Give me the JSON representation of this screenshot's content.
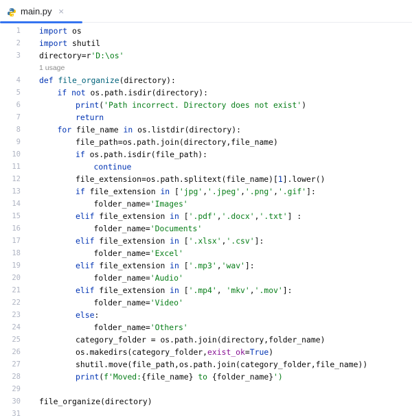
{
  "tab": {
    "filename": "main.py",
    "close": "×"
  },
  "usage_hint": "1 usage",
  "lines": [
    {
      "n": "1",
      "indent": 0,
      "tokens": [
        {
          "t": "import",
          "c": "kw"
        },
        {
          "t": " os"
        }
      ]
    },
    {
      "n": "2",
      "indent": 0,
      "tokens": [
        {
          "t": "import",
          "c": "kw"
        },
        {
          "t": " shutil"
        }
      ]
    },
    {
      "n": "3",
      "indent": 0,
      "tokens": [
        {
          "t": "directory=r"
        },
        {
          "t": "'D:\\os'",
          "c": "str"
        }
      ]
    },
    {
      "n": "4",
      "indent": 0,
      "usage": true,
      "tokens": [
        {
          "t": "def",
          "c": "kw"
        },
        {
          "t": " "
        },
        {
          "t": "file_organize",
          "c": "fn"
        },
        {
          "t": "(directory):"
        }
      ]
    },
    {
      "n": "5",
      "indent": 1,
      "tokens": [
        {
          "t": "if not",
          "c": "kw"
        },
        {
          "t": " os.path.isdir(directory):"
        }
      ]
    },
    {
      "n": "6",
      "indent": 2,
      "tokens": [
        {
          "t": "print",
          "c": "kw"
        },
        {
          "t": "("
        },
        {
          "t": "'Path incorrect. Directory does not exist'",
          "c": "str"
        },
        {
          "t": ")"
        }
      ]
    },
    {
      "n": "7",
      "indent": 2,
      "tokens": [
        {
          "t": "return",
          "c": "kw"
        }
      ]
    },
    {
      "n": "8",
      "indent": 1,
      "tokens": [
        {
          "t": "for",
          "c": "kw"
        },
        {
          "t": " file_name "
        },
        {
          "t": "in",
          "c": "kw"
        },
        {
          "t": " os.listdir(directory):"
        }
      ]
    },
    {
      "n": "9",
      "indent": 2,
      "tokens": [
        {
          "t": "file_path=os.path.join(directory,file_name)"
        }
      ]
    },
    {
      "n": "10",
      "indent": 2,
      "tokens": [
        {
          "t": "if",
          "c": "kw"
        },
        {
          "t": " os.path.isdir(file_path):"
        }
      ]
    },
    {
      "n": "11",
      "indent": 3,
      "tokens": [
        {
          "t": "continue",
          "c": "kw"
        }
      ]
    },
    {
      "n": "12",
      "indent": 2,
      "tokens": [
        {
          "t": "file_extension=os.path.splitext(file_name)["
        },
        {
          "t": "1",
          "c": "kw"
        },
        {
          "t": "].lower()"
        }
      ]
    },
    {
      "n": "13",
      "indent": 2,
      "tokens": [
        {
          "t": "if",
          "c": "kw"
        },
        {
          "t": " file_extension "
        },
        {
          "t": "in",
          "c": "kw"
        },
        {
          "t": " ["
        },
        {
          "t": "'jpg'",
          "c": "str"
        },
        {
          "t": ","
        },
        {
          "t": "'.jpeg'",
          "c": "str"
        },
        {
          "t": ","
        },
        {
          "t": "'.png'",
          "c": "str"
        },
        {
          "t": ","
        },
        {
          "t": "'.gif'",
          "c": "str"
        },
        {
          "t": "]:"
        }
      ]
    },
    {
      "n": "14",
      "indent": 3,
      "tokens": [
        {
          "t": "folder_name="
        },
        {
          "t": "'Images'",
          "c": "str"
        }
      ]
    },
    {
      "n": "15",
      "indent": 2,
      "tokens": [
        {
          "t": "elif",
          "c": "kw"
        },
        {
          "t": " file_extension "
        },
        {
          "t": "in",
          "c": "kw"
        },
        {
          "t": " ["
        },
        {
          "t": "'.pdf'",
          "c": "str"
        },
        {
          "t": ","
        },
        {
          "t": "'.docx'",
          "c": "str"
        },
        {
          "t": ","
        },
        {
          "t": "'.txt'",
          "c": "str"
        },
        {
          "t": "] :"
        }
      ]
    },
    {
      "n": "16",
      "indent": 3,
      "tokens": [
        {
          "t": "folder_name="
        },
        {
          "t": "'Documents'",
          "c": "str"
        }
      ]
    },
    {
      "n": "17",
      "indent": 2,
      "tokens": [
        {
          "t": "elif",
          "c": "kw"
        },
        {
          "t": " file_extension "
        },
        {
          "t": "in",
          "c": "kw"
        },
        {
          "t": " ["
        },
        {
          "t": "'.xlsx'",
          "c": "str"
        },
        {
          "t": ","
        },
        {
          "t": "'.csv'",
          "c": "str"
        },
        {
          "t": "]:"
        }
      ]
    },
    {
      "n": "18",
      "indent": 3,
      "tokens": [
        {
          "t": "folder_name="
        },
        {
          "t": "'Excel'",
          "c": "str"
        }
      ]
    },
    {
      "n": "19",
      "indent": 2,
      "tokens": [
        {
          "t": "elif",
          "c": "kw"
        },
        {
          "t": " file_extension "
        },
        {
          "t": "in",
          "c": "kw"
        },
        {
          "t": " ["
        },
        {
          "t": "'.mp3'",
          "c": "str"
        },
        {
          "t": ","
        },
        {
          "t": "'wav'",
          "c": "str"
        },
        {
          "t": "]:"
        }
      ]
    },
    {
      "n": "20",
      "indent": 3,
      "tokens": [
        {
          "t": "folder_name="
        },
        {
          "t": "'Audio'",
          "c": "str"
        }
      ]
    },
    {
      "n": "21",
      "indent": 2,
      "tokens": [
        {
          "t": "elif",
          "c": "kw"
        },
        {
          "t": " file_extension "
        },
        {
          "t": "in",
          "c": "kw"
        },
        {
          "t": " ["
        },
        {
          "t": "'.mp4'",
          "c": "str"
        },
        {
          "t": ", "
        },
        {
          "t": "'mkv'",
          "c": "str"
        },
        {
          "t": ","
        },
        {
          "t": "'.mov'",
          "c": "str"
        },
        {
          "t": "]:"
        }
      ]
    },
    {
      "n": "22",
      "indent": 3,
      "tokens": [
        {
          "t": "folder_name="
        },
        {
          "t": "'Video'",
          "c": "str"
        }
      ]
    },
    {
      "n": "23",
      "indent": 2,
      "tokens": [
        {
          "t": "else",
          "c": "kw"
        },
        {
          "t": ":"
        }
      ]
    },
    {
      "n": "24",
      "indent": 3,
      "tokens": [
        {
          "t": "folder_name="
        },
        {
          "t": "'Others'",
          "c": "str"
        }
      ]
    },
    {
      "n": "25",
      "indent": 2,
      "tokens": [
        {
          "t": "category_folder = os.path.join(directory,folder_name)"
        }
      ]
    },
    {
      "n": "26",
      "indent": 2,
      "tokens": [
        {
          "t": "os.makedirs(category_folder,"
        },
        {
          "t": "exist_ok",
          "c": "param"
        },
        {
          "t": "="
        },
        {
          "t": "True",
          "c": "kw"
        },
        {
          "t": ")"
        }
      ]
    },
    {
      "n": "27",
      "indent": 2,
      "tokens": [
        {
          "t": "shutil.move(file_path,os.path.join(category_folder,file_name))"
        }
      ]
    },
    {
      "n": "28",
      "indent": 2,
      "tokens": [
        {
          "t": "print",
          "c": "kw"
        },
        {
          "t": "("
        },
        {
          "t": "f'Moved:",
          "c": "str"
        },
        {
          "t": "{file_name}"
        },
        {
          "t": " to ",
          "c": "str"
        },
        {
          "t": "{folder_name}"
        },
        {
          "t": "')",
          "c": "str"
        }
      ]
    },
    {
      "n": "29",
      "indent": 0,
      "tokens": []
    },
    {
      "n": "30",
      "indent": 0,
      "tokens": [
        {
          "t": "file_organize(directory)"
        }
      ]
    },
    {
      "n": "31",
      "indent": 0,
      "tokens": []
    }
  ]
}
